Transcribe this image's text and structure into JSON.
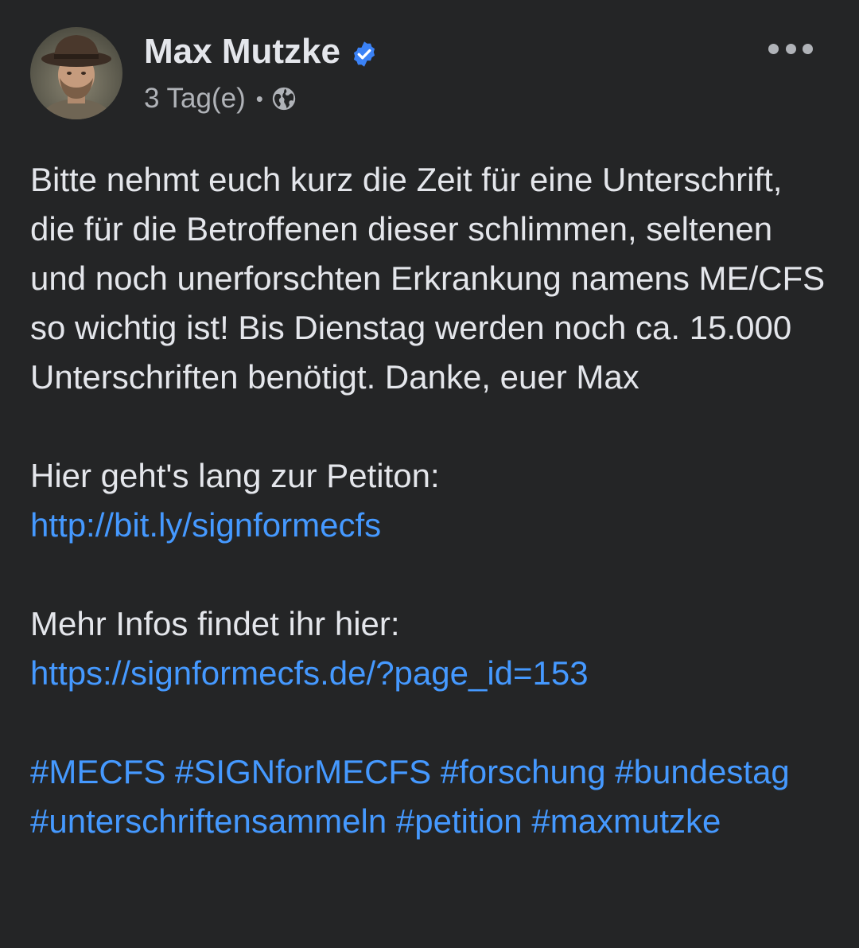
{
  "post": {
    "author": {
      "name": "Max Mutzke",
      "avatar_icon": "avatar-photo",
      "verified_icon": "verified-badge-icon",
      "verified_color": "#3b82f6"
    },
    "meta": {
      "time": "3 Tag(e)",
      "separator": "•",
      "privacy_icon": "globe-icon"
    },
    "more_icon": "more-options-icon",
    "body": {
      "paragraph1": "Bitte nehmt euch kurz die Zeit für eine Unterschrift, die für die Betroffenen dieser schlimmen, seltenen und noch unerforschten Erkrankung namens ME/CFS so wichtig ist! Bis Dienstag werden noch ca. 15.000 Unterschriften benötigt. Danke, euer Max",
      "petition_label": "Hier geht's lang zur Petiton:",
      "petition_link": "http://bit.ly/signformecfs",
      "info_label": "Mehr Infos findet ihr hier:",
      "info_link": "https://signformecfs.de/?page_id=153",
      "hashtags": [
        "#MECFS",
        "#SIGNforMECFS",
        "#forschung",
        "#bundestag",
        "#unterschriftensammeln",
        "#petition",
        "#maxmutzke"
      ]
    }
  },
  "colors": {
    "background": "#242526",
    "text_primary": "#e4e6eb",
    "text_secondary": "#b0b3b8",
    "link": "#4599ff"
  }
}
